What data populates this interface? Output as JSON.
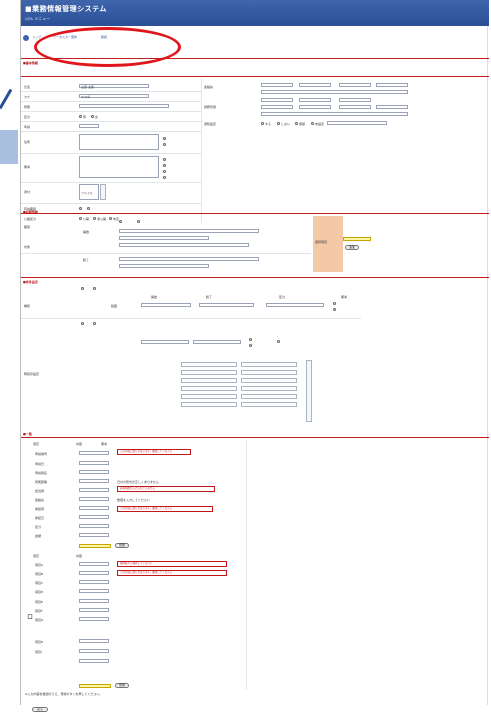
{
  "header": {
    "title": "■業務情報管理システム",
    "subtitle": "ｼｽﾃﾑ メニュー"
  },
  "breadcrumb": {
    "items": [
      "トップ",
      "データ入力・更新",
      "確認"
    ]
  },
  "sections": {
    "basic": {
      "title": "■基本情報"
    },
    "detail": {
      "title": "■詳細情報"
    },
    "conditions": {
      "title": "■条件設定"
    },
    "list": {
      "title": "■一覧"
    }
  },
  "basic_form": {
    "left_labels": [
      "氏名",
      "カナ",
      "所属",
      "区分",
      "性別",
      "年齢",
      "住所",
      "備考",
      "添付",
      "有効期間",
      "公開区分"
    ],
    "right_labels": [
      "連絡先",
      "電話",
      "勤務形態",
      "メール",
      "通知設定"
    ],
    "name_value": "山田 太郎",
    "kana_value": "ヤマダ",
    "file_value": "ファイル"
  },
  "radio_options": {
    "gender": [
      "男",
      "女"
    ],
    "publish": [
      "公開",
      "非公開",
      "未定"
    ],
    "notice": [
      "する",
      "しない",
      "保留",
      "未設定"
    ]
  },
  "detail_form": {
    "labels": [
      "期間",
      "対象",
      "開始",
      "終了"
    ],
    "side_label": "選択項目"
  },
  "conditions_form": {
    "labels": [
      "種別",
      "範囲",
      "時間帯設定"
    ],
    "headers": [
      "開始",
      "終了",
      "区分",
      "備考"
    ]
  },
  "list_form": {
    "headers": [
      "項目",
      "内容",
      "備考"
    ],
    "rows": [
      "申請番号",
      "申請日",
      "申請者名",
      "所属部署",
      "担当者",
      "連絡先",
      "承認者",
      "承認日",
      "区分",
      "金額",
      "備考"
    ],
    "lower_rows": [
      "項目A",
      "項目B",
      "項目C",
      "項目D",
      "項目E",
      "項目F",
      "項目G",
      "項目H",
      "項目I"
    ],
    "errors": [
      "入力内容に誤りがあります。確認してください",
      "日付の形式が正しくありません",
      "必須項目が入力されていません",
      "数値を入力してください",
      "入力内容に誤りがあります。確認してください",
      "選択肢から選択してください",
      "入力内容に誤りがあります。確認してください"
    ]
  },
  "buttons": {
    "add": "追加",
    "register": "登録",
    "confirm": "確認",
    "back": "戻る"
  },
  "footer": {
    "note": "※入力内容を確認のうえ、登録ボタンを押してください。"
  },
  "colors": {
    "header": "#2a4f96",
    "section_rule": "#c61b1b",
    "highlight": "#e0161c",
    "orange": "#f3c9a6",
    "yellow_input": "#fff6a6"
  }
}
